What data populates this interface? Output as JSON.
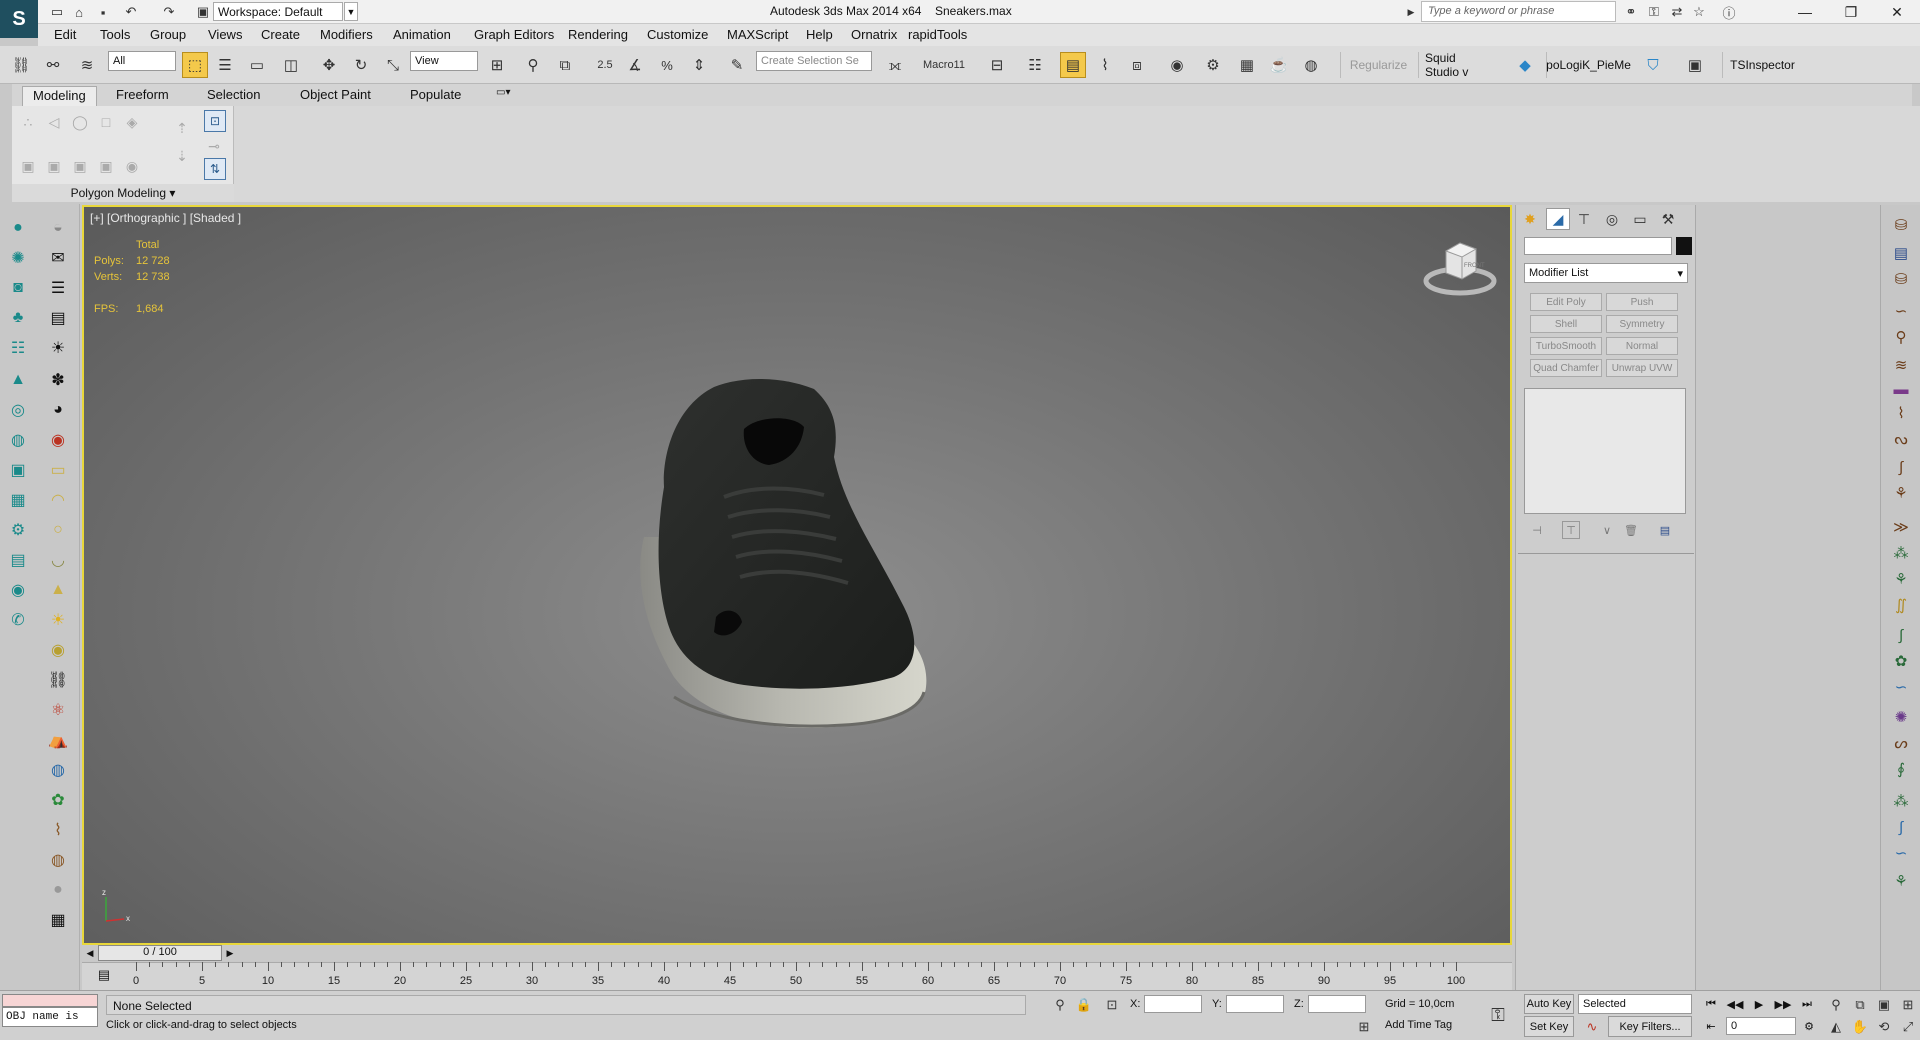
{
  "window": {
    "app_title": "Autodesk 3ds Max  2014 x64",
    "file_name": "Sneakers.max",
    "workspace": "Workspace: Default",
    "search_placeholder": "Type a keyword or phrase"
  },
  "menu": [
    "Edit",
    "Tools",
    "Group",
    "Views",
    "Create",
    "Modifiers",
    "Animation",
    "Graph Editors",
    "Rendering",
    "Customize",
    "MAXScript",
    "Help",
    "Ornatrix",
    "rapidTools"
  ],
  "toolbar": {
    "selection_filter": "All",
    "ref_coord": "View",
    "snap_label": "2.5",
    "named_selection_placeholder": "Create Selection Se",
    "macro": "Macro11",
    "regularize": "Regularize",
    "squid": "Squid Studio v",
    "topologik": "poLogiK_PieMe",
    "tsinspector": "TSInspector"
  },
  "ribbon": {
    "tabs": [
      "Modeling",
      "Freeform",
      "Selection",
      "Object Paint",
      "Populate"
    ],
    "active_tab": "Modeling",
    "panel_title": "Polygon Modeling"
  },
  "viewport": {
    "label": "[+] [Orthographic ] [Shaded ]",
    "stats": {
      "total_label": "Total",
      "polys_label": "Polys:",
      "polys_value": "12 728",
      "verts_label": "Verts:",
      "verts_value": "12 738",
      "fps_label": "FPS:",
      "fps_value": "1,684"
    },
    "viewcube_face": "FRONT",
    "border_color": "#e8d73a"
  },
  "timeline": {
    "slider_text": "0 / 100",
    "ticks": [
      "0",
      "5",
      "10",
      "15",
      "20",
      "25",
      "30",
      "35",
      "40",
      "45",
      "50",
      "55",
      "60",
      "65",
      "70",
      "75",
      "80",
      "85",
      "90",
      "95",
      "100"
    ]
  },
  "command_panel": {
    "modifier_list": "Modifier List",
    "modifier_buttons": [
      "Edit Poly",
      "Push",
      "Shell",
      "Symmetry",
      "TurboSmooth",
      "Normal",
      "Quad Chamfer",
      "Unwrap UVW"
    ]
  },
  "status": {
    "listener_text": "OBJ name is",
    "selection": "None Selected",
    "prompt": "Click or click-and-drag to select objects",
    "x_label": "X:",
    "y_label": "Y:",
    "z_label": "Z:",
    "grid": "Grid = 10,0cm",
    "add_time_tag": "Add Time Tag",
    "auto_key": "Auto Key",
    "set_key": "Set Key",
    "selected": "Selected",
    "key_filters": "Key Filters...",
    "frame": "0"
  }
}
